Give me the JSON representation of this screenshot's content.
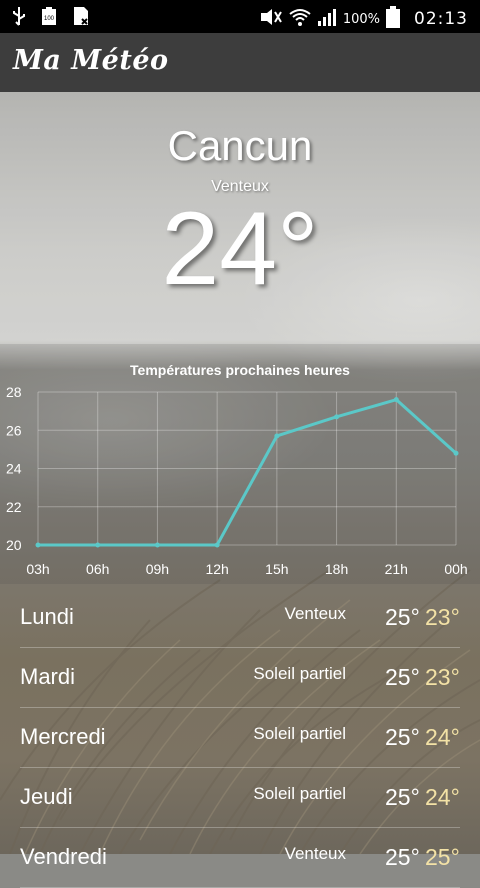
{
  "statusbar": {
    "battery_percent": "100%",
    "time": "02:13",
    "battery_small_label": "100"
  },
  "app": {
    "title": "Ma Météo"
  },
  "current": {
    "city": "Cancun",
    "condition": "Venteux",
    "temperature": "24°"
  },
  "chart_data": {
    "type": "line",
    "title": "Températures prochaines heures",
    "categories": [
      "03h",
      "06h",
      "09h",
      "12h",
      "15h",
      "18h",
      "21h",
      "00h"
    ],
    "values": [
      20,
      20,
      20,
      20,
      25.7,
      26.7,
      27.6,
      24.8
    ],
    "ylim": [
      20,
      28
    ],
    "yticks": [
      "20",
      "22",
      "24",
      "26",
      "28"
    ],
    "line_color": "#5bc8c8",
    "grid": true
  },
  "forecast": [
    {
      "day": "Lundi",
      "condition": "Venteux",
      "high": "25°",
      "low": "23°"
    },
    {
      "day": "Mardi",
      "condition": "Soleil partiel",
      "high": "25°",
      "low": "23°"
    },
    {
      "day": "Mercredi",
      "condition": "Soleil partiel",
      "high": "25°",
      "low": "24°"
    },
    {
      "day": "Jeudi",
      "condition": "Soleil partiel",
      "high": "25°",
      "low": "24°"
    },
    {
      "day": "Vendredi",
      "condition": "Venteux",
      "high": "25°",
      "low": "25°"
    }
  ]
}
